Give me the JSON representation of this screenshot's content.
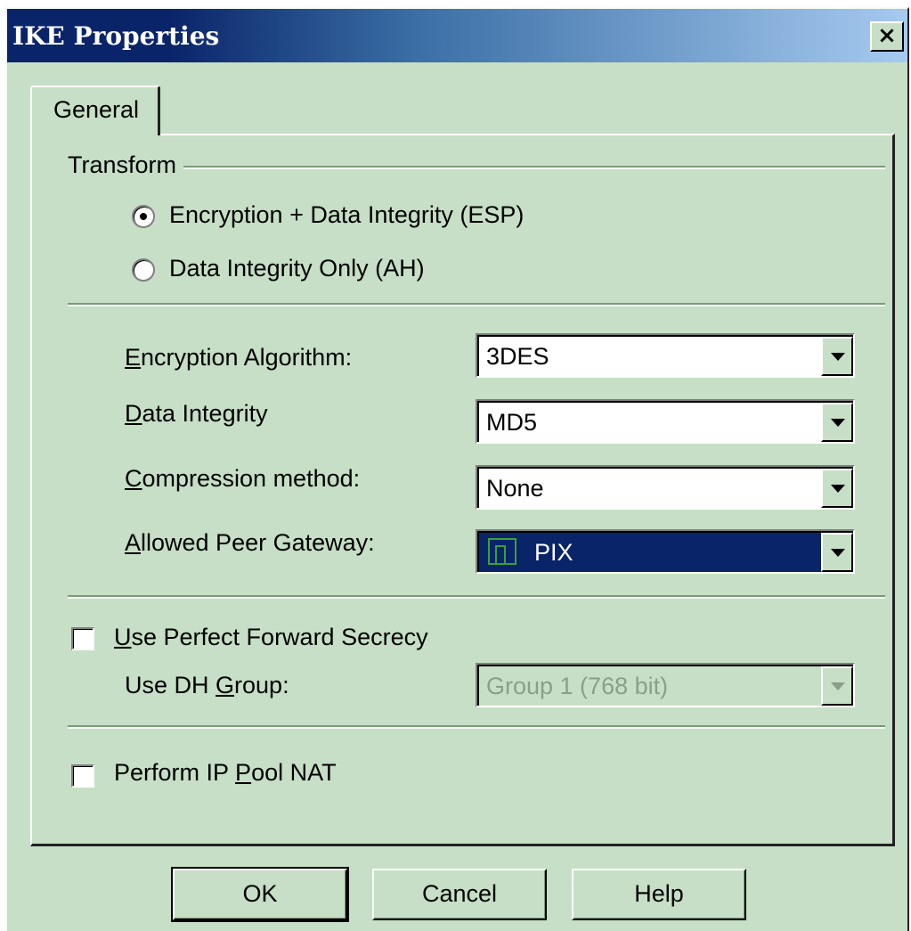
{
  "window": {
    "title": "IKE Properties",
    "close_label": "×"
  },
  "tabs": [
    {
      "label": "General"
    }
  ],
  "transform": {
    "group_label": "Transform",
    "options": [
      {
        "label": "Encryption + Data Integrity (ESP)",
        "selected": true
      },
      {
        "label": "Data Integrity Only (AH)",
        "selected": false
      }
    ]
  },
  "fields": {
    "encryption": {
      "label_mnemonic": "E",
      "label_rest": "ncryption Algorithm:",
      "value": "3DES"
    },
    "integrity": {
      "label_mnemonic": "D",
      "label_rest": "ata Integrity",
      "value": "MD5"
    },
    "compression": {
      "label_mnemonic": "C",
      "label_rest": "ompression method:",
      "value": "None"
    },
    "peer": {
      "label_mnemonic": "A",
      "label_rest": "llowed Peer Gateway:",
      "value": "PIX",
      "icon": "pix-gateway-icon"
    }
  },
  "pfs": {
    "label_mnemonic": "U",
    "label_rest": "se Perfect Forward Secrecy",
    "checked": false,
    "dh_label_pre": "Use DH ",
    "dh_label_mnemonic": "G",
    "dh_label_post": "roup:",
    "dh_value": "Group 1 (768 bit)"
  },
  "nat": {
    "label_pre": "Perform IP ",
    "label_mnemonic": "P",
    "label_post": "ool NAT",
    "checked": false
  },
  "buttons": {
    "ok": "OK",
    "cancel": "Cancel",
    "help": "Help"
  },
  "colors": {
    "face": "#c6dfc6",
    "title_start": "#0a246a",
    "title_end": "#a6caf0",
    "selection": "#0a246a",
    "icon_green": "#3aa03a"
  }
}
